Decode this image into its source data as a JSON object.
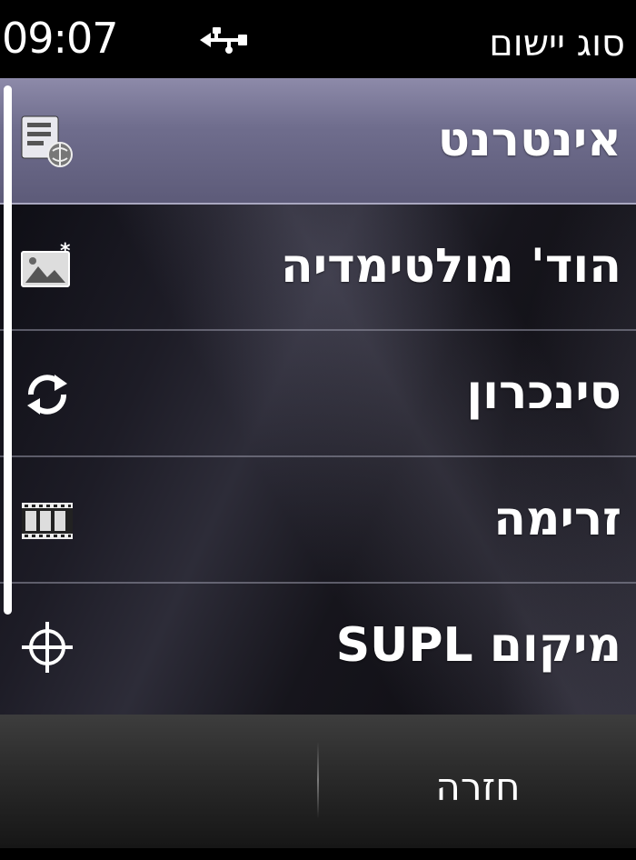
{
  "status_bar": {
    "time": "09:07",
    "connection_icon": "usb-icon",
    "title": "סוג יישום"
  },
  "list": {
    "items": [
      {
        "label": "אינטרנט",
        "icon": "internet-settings-icon",
        "selected": true
      },
      {
        "label": "הוד' מולטימדיה",
        "icon": "multimedia-message-icon",
        "selected": false
      },
      {
        "label": "סינכרון",
        "icon": "sync-icon",
        "selected": false
      },
      {
        "label": "זרימה",
        "icon": "streaming-film-icon",
        "selected": false
      },
      {
        "label": "מיקום SUPL",
        "icon": "location-crosshair-icon",
        "selected": false
      }
    ]
  },
  "softkeys": {
    "left_label": "",
    "back_label": "חזרה"
  },
  "colors": {
    "selected_row": "#6f6d8d",
    "background": "#000000",
    "text": "#ffffff"
  }
}
